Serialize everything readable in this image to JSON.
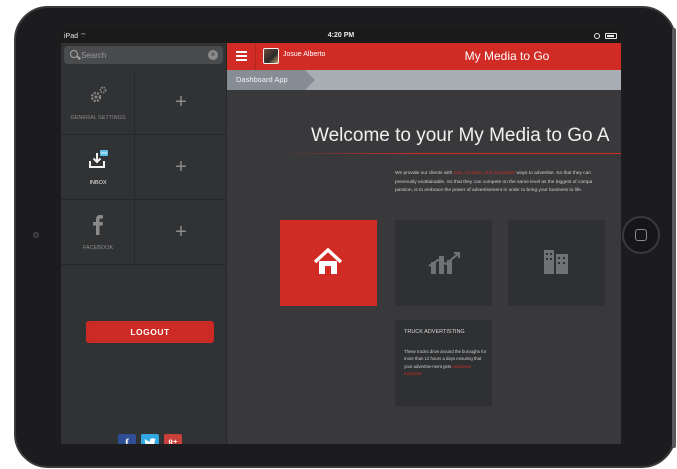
{
  "status_bar": {
    "device": "iPad",
    "time": "4:20 PM"
  },
  "search": {
    "placeholder": "Search"
  },
  "sidebar": {
    "tiles": [
      {
        "label": "GENERAL SETTINGS",
        "icon": "gears-icon"
      },
      {
        "label": "INBOX",
        "icon": "inbox-icon",
        "badge_icon": "chat-bubble-icon"
      },
      {
        "label": "FACEBOOK",
        "icon": "facebook-icon"
      }
    ],
    "add_label": "+",
    "logout_label": "LOGOUT",
    "social": {
      "facebook": "f",
      "google_plus": "8⁺"
    }
  },
  "topbar": {
    "username": "Josue Alberto",
    "title": "My Media to Go"
  },
  "breadcrumb": {
    "label": "Dashboard App"
  },
  "main": {
    "welcome": "Welcome to your My Media to Go A",
    "intro_lines": {
      "l1a": "We provide our clients with ",
      "l1b": "new, creative, and innovative",
      "l1c": " ways to advertise. So that they can",
      "l2": "previously unattainable. So that they can compete on the same level as the biggest of compa",
      "l3": "passion, is to embrace the power of advertisement in order to bring your business to life."
    },
    "truck_card": {
      "title": "TRUCK ADVERTISTING",
      "body_1": "These trucks drive around the boroughs for more than 12 hours a days ensuring that your advertise-ment gets ",
      "body_highlight": "maximum exposure"
    }
  },
  "colors": {
    "accent": "#d02b25",
    "sidebar": "#313234",
    "main": "#39393b",
    "breadcrumb": "#868d94"
  }
}
